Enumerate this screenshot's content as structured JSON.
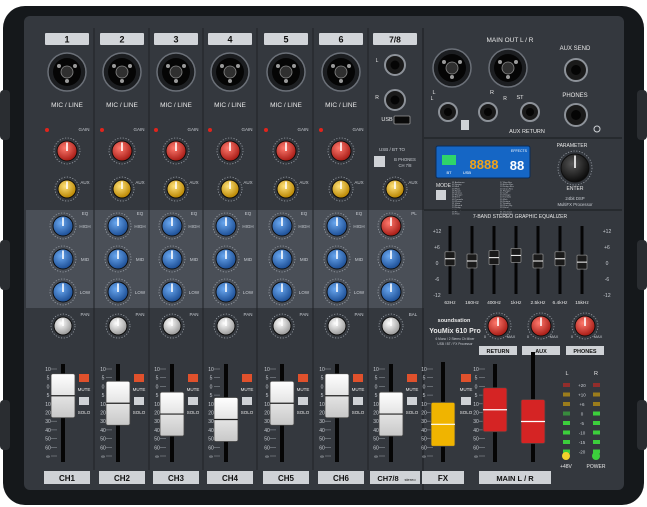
{
  "channels": [
    {
      "number": "1",
      "label": "CH1"
    },
    {
      "number": "2",
      "label": "CH2"
    },
    {
      "number": "3",
      "label": "CH3"
    },
    {
      "number": "4",
      "label": "CH4"
    },
    {
      "number": "5",
      "label": "CH5"
    },
    {
      "number": "6",
      "label": "CH6"
    }
  ],
  "stereo_channel": {
    "number": "7/8",
    "label": "CH7/8",
    "sublabel": "stereo",
    "usb_label": "USB",
    "usb_bt_label": "USB / BT TO",
    "headphone_switch": [
      "B PHONES",
      "CH 7/8"
    ],
    "input_l": "L",
    "input_r": "R",
    "mono_l": "L MONO"
  },
  "mic_line_label": "MIC / LINE",
  "knob_labels": {
    "gain": "GAIN",
    "pk": "PK",
    "aux": "AUX",
    "fx": "/FX",
    "eq": "EQ",
    "high": "HIGH",
    "mid": "MID",
    "low": "LOW",
    "pan": "PAN",
    "bal": "BAL",
    "pl": "PL"
  },
  "button_labels": {
    "mute": "MUTE",
    "solo": "SOLO"
  },
  "main_out": {
    "label": "MAIN OUT L / R",
    "l": "L",
    "r": "R"
  },
  "aux_send": {
    "label": "AUX SEND"
  },
  "phones_jack": {
    "label": "PHONES"
  },
  "st_aux_return": {
    "label": "ST",
    "sublabel": "AUX RETURN",
    "l": "L",
    "r": "R"
  },
  "display": {
    "digits": "8888",
    "preset": "88",
    "brand_badge": "EFFECTS",
    "bt": "BT",
    "usb": "USB"
  },
  "parameter": {
    "label": "PARAMETER",
    "enter": "ENTER"
  },
  "mode": {
    "label": "MODE"
  },
  "fx_info": {
    "line1": "24bit DSP",
    "line2": "MultiFX Processor"
  },
  "effects_list": [
    "01 Ambience",
    "02 Spring",
    "03 Hall",
    "04 Plate",
    "05 Room",
    "06 Chorus",
    "07 Flanger",
    "08 Echo",
    "09 Tremolo",
    "10 Phaser",
    "11 Voice",
    "12 Reverb",
    "13 Delay",
    "14 Rotary",
    "15 Fx",
    "16 Pitch"
  ],
  "effects_list_right": [
    "17 Slap-Bac",
    "18 Echo+Rev",
    "19 Delay+Rev",
    "20 Chor+Rev",
    "21 Flanger",
    "22 Lo-Fi",
    "23 Vintage",
    "24 Tremolo",
    "25 Wah",
    "26 Detune",
    "27 Doubler",
    "28 Chor+Dly",
    "29 Vocal",
    "30 Rev+Chorus",
    "31 Vox Duet",
    "32 Tap Delay"
  ],
  "graphic_eq": {
    "title": "7-BAND STEREO GRAPHIC EQUALIZER",
    "bands": [
      "63Hz",
      "160Hz",
      "400Hz",
      "1kHz",
      "2.5kHz",
      "6.4kHz",
      "15kHz"
    ],
    "scale": [
      "+12",
      "+6",
      "0",
      "-6",
      "-12"
    ]
  },
  "brand": {
    "name": "soundsation",
    "model": "YouMix 610 Pro",
    "subtitle_1": "6 Mono / 2 Stereo Ch Mixer",
    "subtitle_2": "USB / BT / FX Processor"
  },
  "master_section": {
    "return_label": "RETURN",
    "aux_label": "AUX",
    "phones_label": "PHONES",
    "min": "0",
    "max": "MAX"
  },
  "fx_fader": {
    "label": "FX"
  },
  "main_fader": {
    "label": "MAIN L / R"
  },
  "meter": {
    "header_l": "L",
    "header_r": "R",
    "labels": [
      "+20",
      "+10",
      "+6",
      "0",
      "-5",
      "-10",
      "-15",
      "-20"
    ],
    "phantom": "+48V",
    "power": "POWER"
  },
  "fader_scale": [
    "10",
    "5",
    "0",
    "5",
    "10",
    "20",
    "30",
    "40",
    "50",
    "60",
    "∞"
  ],
  "fader_levels": {
    "ch1": 0.18,
    "ch2": 0.32,
    "ch3": 0.52,
    "ch4": 0.62,
    "ch5": 0.32,
    "ch6": 0.18,
    "ch78": 0.52,
    "fx": 0.72,
    "main_l": 0.44,
    "main_r": 0.72
  },
  "colors": {
    "chassis": "#1b1e22",
    "panel": "#3a3e45",
    "eq_band": "#5a5f68",
    "knob_blue": "#2f6fc4",
    "knob_red": "#d8342c",
    "knob_yellow": "#e6b317",
    "fader_white": "#eeeeee",
    "fader_red": "#d52424",
    "fader_yellow": "#f0b400",
    "lcd": "#1566c5"
  }
}
